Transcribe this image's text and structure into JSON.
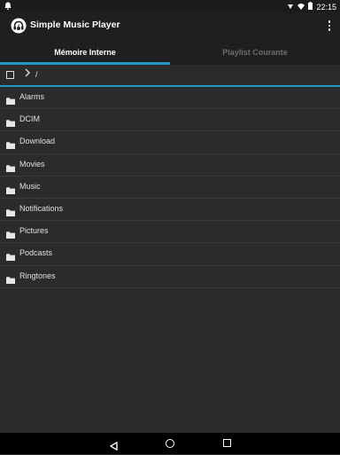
{
  "status_bar": {
    "time": "22:15",
    "icons": [
      "notification-icon",
      "wifi-icon",
      "signal-icon",
      "battery-icon"
    ]
  },
  "app_bar": {
    "title": "Simple Music Player",
    "app_icon": "headphones-icon",
    "overflow_icon": "more-vert-icon"
  },
  "tabs": [
    {
      "label": "Mémoire Interne",
      "active": true
    },
    {
      "label": "Playlist Courante",
      "active": false
    }
  ],
  "path_bar": {
    "path": "/",
    "checkbox_icon": "checkbox-icon",
    "chevron_icon": "chevron-right-icon"
  },
  "folders": [
    {
      "name": "Alarms"
    },
    {
      "name": "DCIM"
    },
    {
      "name": "Download"
    },
    {
      "name": "Movies"
    },
    {
      "name": "Music"
    },
    {
      "name": "Notifications"
    },
    {
      "name": "Pictures"
    },
    {
      "name": "Podcasts"
    },
    {
      "name": "Ringtones"
    }
  ],
  "colors": {
    "accent": "#2196c7",
    "background": "#2b2b2b",
    "bar": "#1f1f1f"
  }
}
